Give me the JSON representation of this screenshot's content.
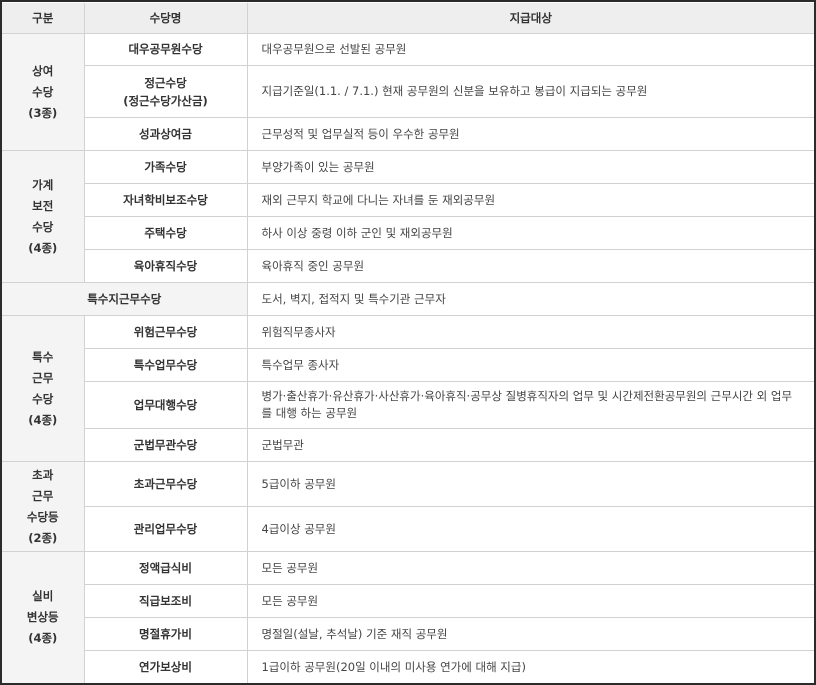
{
  "header": {
    "category": "구분",
    "name": "수당명",
    "target": "지급대상"
  },
  "groups": [
    {
      "category": "상여\n수당\n(3종)",
      "rows": [
        {
          "name": "대우공무원수당",
          "target": "대우공무원으로 선발된 공무원"
        },
        {
          "name": "정근수당\n(정근수당가산금)",
          "target": "지급기준일(1.1. / 7.1.) 현재 공무원의 신분을 보유하고 봉급이 지급되는 공무원"
        },
        {
          "name": "성과상여금",
          "target": "근무성적 및 업무실적 등이 우수한 공무원"
        }
      ]
    },
    {
      "category": "가계\n보전\n수당\n(4종)",
      "rows": [
        {
          "name": "가족수당",
          "target": "부양가족이 있는 공무원"
        },
        {
          "name": "자녀학비보조수당",
          "target": "재외 근무지 학교에 다니는 자녀를 둔 재외공무원"
        },
        {
          "name": "주택수당",
          "target": "하사 이상 중령 이하 군인 및 재외공무원"
        },
        {
          "name": "육아휴직수당",
          "target": "육아휴직 중인 공무원"
        }
      ]
    },
    {
      "single": true,
      "name": "특수지근무수당",
      "target": "도서, 벽지, 접적지 및 특수기관 근무자"
    },
    {
      "category": "특수\n근무\n수당\n(4종)",
      "rows": [
        {
          "name": "위험근무수당",
          "target": "위험직무종사자"
        },
        {
          "name": "특수업무수당",
          "target": "특수업무 종사자"
        },
        {
          "name": "업무대행수당",
          "target": "병가·출산휴가·유산휴가·사산휴가·육아휴직·공무상 질병휴직자의 업무 및 시간제전환공무원의 근무시간 외 업무를 대행 하는 공무원"
        },
        {
          "name": "군법무관수당",
          "target": "군법무관"
        }
      ]
    },
    {
      "category": "초과\n근무\n수당등\n(2종)",
      "rows": [
        {
          "name": "초과근무수당",
          "target": "5급이하 공무원"
        },
        {
          "name": "관리업무수당",
          "target": "4급이상 공무원"
        }
      ]
    },
    {
      "category": "실비\n변상등\n(4종)",
      "rows": [
        {
          "name": "정액급식비",
          "target": "모든 공무원"
        },
        {
          "name": "직급보조비",
          "target": "모든 공무원"
        },
        {
          "name": "명절휴가비",
          "target": "명절일(설날, 추석날) 기준 재직 공무원"
        },
        {
          "name": "연가보상비",
          "target": "1급이하 공무원(20일 이내의 미사용 연가에 대해 지급)"
        }
      ]
    }
  ]
}
